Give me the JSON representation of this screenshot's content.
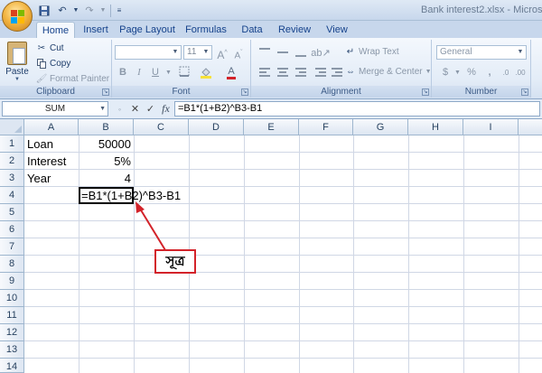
{
  "window": {
    "title": "Bank interest2.xlsx - Microsoft Ex"
  },
  "ribbon": {
    "tabs": [
      "Home",
      "Insert",
      "Page Layout",
      "Formulas",
      "Data",
      "Review",
      "View"
    ],
    "active_tab": "Home",
    "clipboard": {
      "paste_label": "Paste",
      "cut_label": "Cut",
      "copy_label": "Copy",
      "format_painter_label": "Format Painter",
      "group_label": "Clipboard"
    },
    "font": {
      "font_size": "11",
      "group_label": "Font"
    },
    "alignment": {
      "wrap_text_label": "Wrap Text",
      "merge_center_label": "Merge & Center",
      "group_label": "Alignment"
    },
    "number": {
      "format_value": "General",
      "percent_symbol": "%",
      "comma_symbol": ",",
      "group_label": "Number"
    }
  },
  "formula_bar": {
    "name_box": "SUM",
    "cancel_symbol": "✕",
    "enter_symbol": "✓",
    "fx_symbol": "fx",
    "formula": "=B1*(1+B2)^B3-B1"
  },
  "sheet": {
    "columns": [
      "A",
      "B",
      "C",
      "D",
      "E",
      "F",
      "G",
      "H",
      "I"
    ],
    "rows": [
      "1",
      "2",
      "3",
      "4",
      "5",
      "6",
      "7",
      "8",
      "9",
      "10",
      "11",
      "12",
      "13",
      "14"
    ],
    "cells": {
      "A1": "Loan",
      "B1": "50000",
      "A2": "Interest",
      "B2": "5%",
      "A3": "Year",
      "B3": "4",
      "B4": "=B1*(1+B2)^B3-B1"
    }
  },
  "annotation": {
    "label": "সূত্র",
    "color": "#d3232a"
  }
}
